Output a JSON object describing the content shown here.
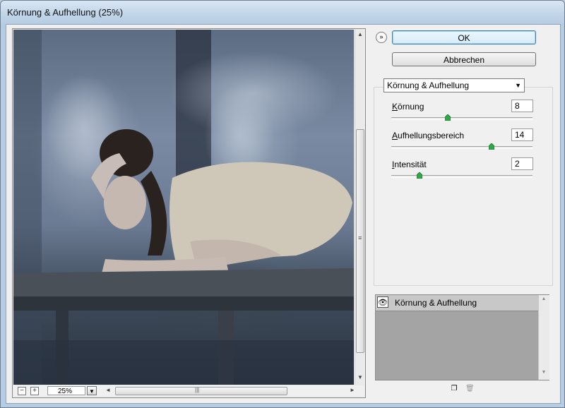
{
  "window": {
    "title": "Körnung & Aufhellung (25%)"
  },
  "preview": {
    "zoom_value": "25%",
    "zoom_out_glyph": "−",
    "zoom_in_glyph": "+",
    "scroll_up": "▲",
    "scroll_down": "▼",
    "scroll_left": "◄",
    "scroll_right": "►",
    "thumb_grip_v": "≡",
    "thumb_grip_h": "|||",
    "dropdown_glyph": "▼"
  },
  "buttons": {
    "ok": "OK",
    "cancel": "Abbrechen",
    "collapse_glyph": "»"
  },
  "filter": {
    "selected": "Körnung & Aufhellung",
    "caret": "▼",
    "params": [
      {
        "label_first": "K",
        "label_rest": "örnung",
        "value": "8",
        "slider_fraction": 0.4
      },
      {
        "label_first": "A",
        "label_rest": "ufhellungsbereich",
        "value": "14",
        "slider_fraction": 0.71
      },
      {
        "label_first": "I",
        "label_rest": "ntensität",
        "value": "2",
        "slider_fraction": 0.2
      }
    ]
  },
  "layers": {
    "items": [
      {
        "name": "Körnung & Aufhellung",
        "visible_glyph": "👁"
      }
    ],
    "new_layer_glyph": "❐",
    "delete_glyph": "🗑"
  },
  "colors": {
    "knob": "#2fa84a",
    "ok_border": "#3c7fb1"
  }
}
